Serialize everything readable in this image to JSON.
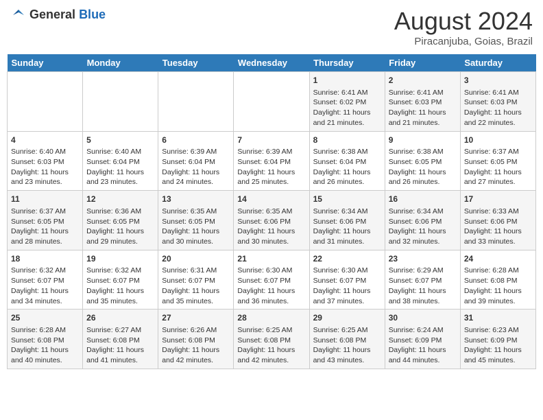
{
  "logo": {
    "general": "General",
    "blue": "Blue"
  },
  "title": "August 2024",
  "location": "Piracanjuba, Goias, Brazil",
  "days_of_week": [
    "Sunday",
    "Monday",
    "Tuesday",
    "Wednesday",
    "Thursday",
    "Friday",
    "Saturday"
  ],
  "weeks": [
    [
      {
        "day": "",
        "info": ""
      },
      {
        "day": "",
        "info": ""
      },
      {
        "day": "",
        "info": ""
      },
      {
        "day": "",
        "info": ""
      },
      {
        "day": "1",
        "sunrise": "6:41 AM",
        "sunset": "6:02 PM",
        "daylight": "11 hours and 21 minutes."
      },
      {
        "day": "2",
        "sunrise": "6:41 AM",
        "sunset": "6:03 PM",
        "daylight": "11 hours and 21 minutes."
      },
      {
        "day": "3",
        "sunrise": "6:41 AM",
        "sunset": "6:03 PM",
        "daylight": "11 hours and 22 minutes."
      }
    ],
    [
      {
        "day": "4",
        "sunrise": "6:40 AM",
        "sunset": "6:03 PM",
        "daylight": "11 hours and 23 minutes."
      },
      {
        "day": "5",
        "sunrise": "6:40 AM",
        "sunset": "6:04 PM",
        "daylight": "11 hours and 23 minutes."
      },
      {
        "day": "6",
        "sunrise": "6:39 AM",
        "sunset": "6:04 PM",
        "daylight": "11 hours and 24 minutes."
      },
      {
        "day": "7",
        "sunrise": "6:39 AM",
        "sunset": "6:04 PM",
        "daylight": "11 hours and 25 minutes."
      },
      {
        "day": "8",
        "sunrise": "6:38 AM",
        "sunset": "6:04 PM",
        "daylight": "11 hours and 26 minutes."
      },
      {
        "day": "9",
        "sunrise": "6:38 AM",
        "sunset": "6:05 PM",
        "daylight": "11 hours and 26 minutes."
      },
      {
        "day": "10",
        "sunrise": "6:37 AM",
        "sunset": "6:05 PM",
        "daylight": "11 hours and 27 minutes."
      }
    ],
    [
      {
        "day": "11",
        "sunrise": "6:37 AM",
        "sunset": "6:05 PM",
        "daylight": "11 hours and 28 minutes."
      },
      {
        "day": "12",
        "sunrise": "6:36 AM",
        "sunset": "6:05 PM",
        "daylight": "11 hours and 29 minutes."
      },
      {
        "day": "13",
        "sunrise": "6:35 AM",
        "sunset": "6:05 PM",
        "daylight": "11 hours and 30 minutes."
      },
      {
        "day": "14",
        "sunrise": "6:35 AM",
        "sunset": "6:06 PM",
        "daylight": "11 hours and 30 minutes."
      },
      {
        "day": "15",
        "sunrise": "6:34 AM",
        "sunset": "6:06 PM",
        "daylight": "11 hours and 31 minutes."
      },
      {
        "day": "16",
        "sunrise": "6:34 AM",
        "sunset": "6:06 PM",
        "daylight": "11 hours and 32 minutes."
      },
      {
        "day": "17",
        "sunrise": "6:33 AM",
        "sunset": "6:06 PM",
        "daylight": "11 hours and 33 minutes."
      }
    ],
    [
      {
        "day": "18",
        "sunrise": "6:32 AM",
        "sunset": "6:07 PM",
        "daylight": "11 hours and 34 minutes."
      },
      {
        "day": "19",
        "sunrise": "6:32 AM",
        "sunset": "6:07 PM",
        "daylight": "11 hours and 35 minutes."
      },
      {
        "day": "20",
        "sunrise": "6:31 AM",
        "sunset": "6:07 PM",
        "daylight": "11 hours and 35 minutes."
      },
      {
        "day": "21",
        "sunrise": "6:30 AM",
        "sunset": "6:07 PM",
        "daylight": "11 hours and 36 minutes."
      },
      {
        "day": "22",
        "sunrise": "6:30 AM",
        "sunset": "6:07 PM",
        "daylight": "11 hours and 37 minutes."
      },
      {
        "day": "23",
        "sunrise": "6:29 AM",
        "sunset": "6:07 PM",
        "daylight": "11 hours and 38 minutes."
      },
      {
        "day": "24",
        "sunrise": "6:28 AM",
        "sunset": "6:08 PM",
        "daylight": "11 hours and 39 minutes."
      }
    ],
    [
      {
        "day": "25",
        "sunrise": "6:28 AM",
        "sunset": "6:08 PM",
        "daylight": "11 hours and 40 minutes."
      },
      {
        "day": "26",
        "sunrise": "6:27 AM",
        "sunset": "6:08 PM",
        "daylight": "11 hours and 41 minutes."
      },
      {
        "day": "27",
        "sunrise": "6:26 AM",
        "sunset": "6:08 PM",
        "daylight": "11 hours and 42 minutes."
      },
      {
        "day": "28",
        "sunrise": "6:25 AM",
        "sunset": "6:08 PM",
        "daylight": "11 hours and 42 minutes."
      },
      {
        "day": "29",
        "sunrise": "6:25 AM",
        "sunset": "6:08 PM",
        "daylight": "11 hours and 43 minutes."
      },
      {
        "day": "30",
        "sunrise": "6:24 AM",
        "sunset": "6:09 PM",
        "daylight": "11 hours and 44 minutes."
      },
      {
        "day": "31",
        "sunrise": "6:23 AM",
        "sunset": "6:09 PM",
        "daylight": "11 hours and 45 minutes."
      }
    ]
  ]
}
